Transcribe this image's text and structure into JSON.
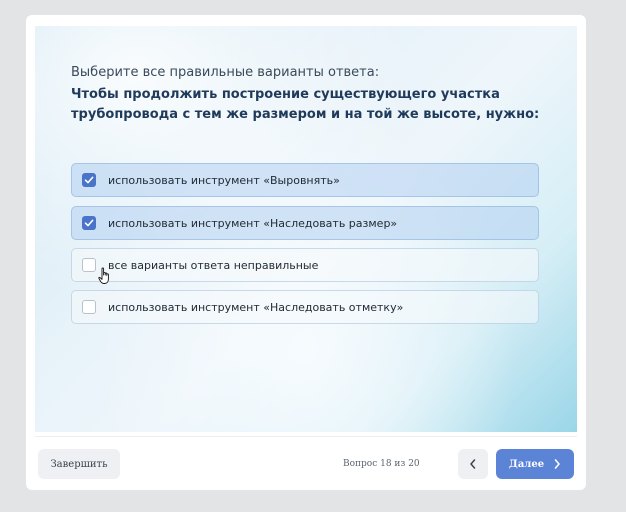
{
  "quiz": {
    "instruction": "Выберите все правильные варианты ответа:",
    "question": "Чтобы продолжить построение существующего участка трубопровода с тем же размером и на той же высоте, нужно:",
    "options": [
      {
        "label": "использовать инструмент «Выровнять»",
        "checked": true
      },
      {
        "label": "использовать инструмент «Наследовать размер»",
        "checked": true
      },
      {
        "label": "все варианты ответа неправильные",
        "checked": false
      },
      {
        "label": "использовать инструмент «Наследовать отметку»",
        "checked": false
      }
    ]
  },
  "footer": {
    "finish_label": "Завершить",
    "progress": "Вопрос 18 из 20",
    "next_label": "Далее"
  },
  "icons": {
    "check": "check-icon",
    "prev": "chevron-left-icon",
    "next": "chevron-right-icon",
    "cursor": "hand-pointer-icon"
  },
  "colors": {
    "accent": "#5b83d6",
    "checkbox_checked": "#4a74c9",
    "question_text": "#1f3a5a"
  }
}
